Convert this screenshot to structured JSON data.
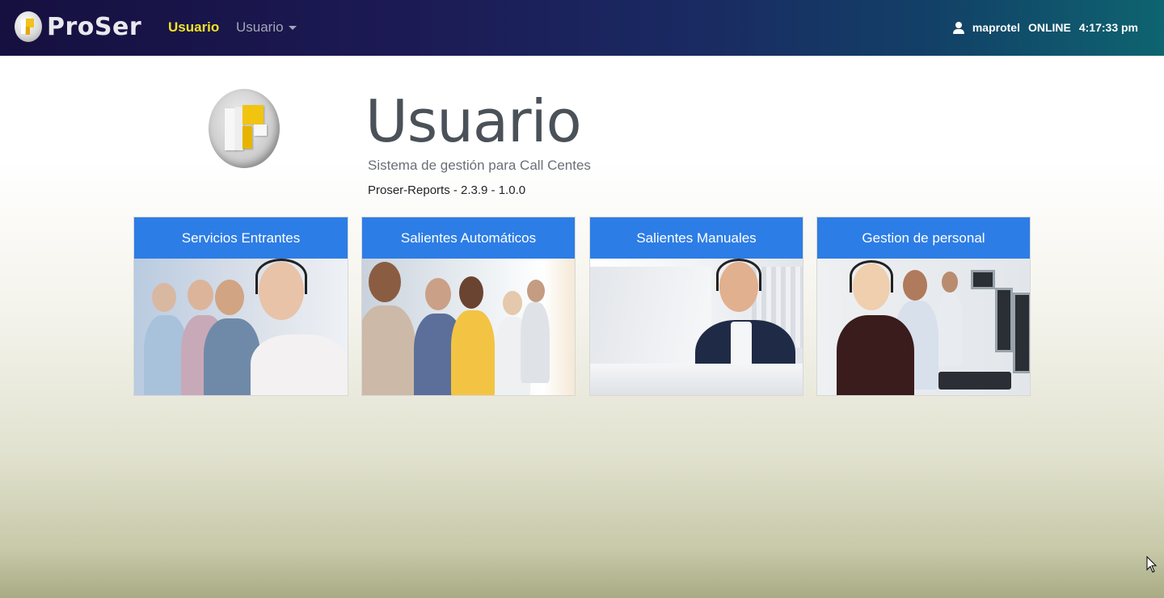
{
  "navbar": {
    "brand": "ProSer",
    "active_link": "Usuario",
    "dropdown_label": "Usuario",
    "username": "maprotel",
    "status": "ONLINE",
    "clock": "4:17:33 pm"
  },
  "hero": {
    "title": "Usuario",
    "subtitle": "Sistema de gestión para Call Centes",
    "version": "Proser-Reports - 2.3.9 - 1.0.0"
  },
  "cards": [
    {
      "title": "Servicios Entrantes"
    },
    {
      "title": "Salientes Automáticos"
    },
    {
      "title": "Salientes Manuales"
    },
    {
      "title": "Gestion de personal"
    }
  ],
  "colors": {
    "card_header": "#2d7de6",
    "active_link": "#f4e324"
  }
}
